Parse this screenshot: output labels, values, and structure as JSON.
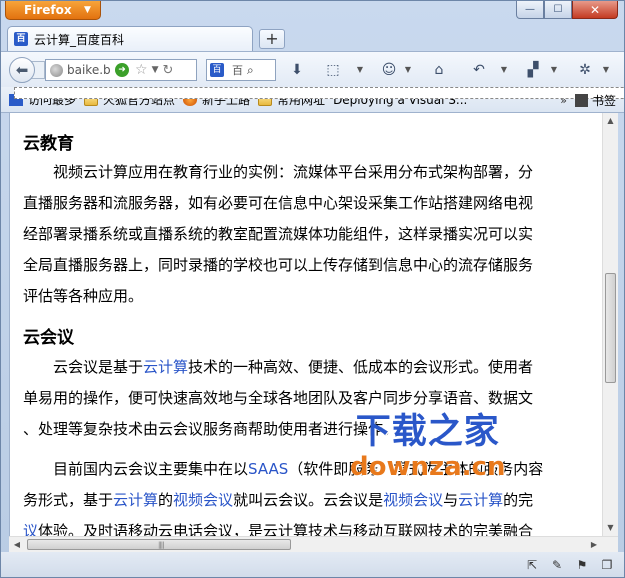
{
  "app": {
    "menu_label": "Firefox"
  },
  "window": {
    "min": "—",
    "max": "☐",
    "close": "✕"
  },
  "tabs": [
    {
      "label": "云计算_百度百科"
    }
  ],
  "tabstrip": {
    "new_tab": "+"
  },
  "nav": {
    "url_text": "baike.ba",
    "search_text": "百",
    "icons": [
      "back-icon",
      "forward-icon",
      "globe-icon",
      "go-icon",
      "star-icon",
      "reload-icon",
      "download-icon",
      "screenshot-icon",
      "smiley-icon",
      "home-icon",
      "history-icon",
      "addons-icon",
      "tools-icon"
    ]
  },
  "bookmarks": {
    "items": [
      {
        "label": "访问最多",
        "icon": "blue"
      },
      {
        "label": "火狐官方站点",
        "icon": "folder"
      },
      {
        "label": "新手上路",
        "icon": "fox"
      },
      {
        "label": "常用网址",
        "icon": "folder"
      },
      {
        "label": "Deploying a Visual S...",
        "icon": "page"
      }
    ],
    "overflow": "»",
    "bookmarks_menu_label": "书签"
  },
  "article": {
    "section1": {
      "heading": "云教育",
      "lines": [
        "　　视频云计算应用在教育行业的实例：流媒体平台采用分布式架构部署，分",
        "直播服务器和流服务器，如有必要可在信息中心架设采集工作站搭建网络电视",
        "经部署录播系统或直播系统的教室配置流媒体功能组件，这样录播实况可以实",
        "全局直播服务器上，同时录播的学校也可以上传存储到信息中心的流存储服务",
        "评估等各种应用。"
      ]
    },
    "section2": {
      "heading": "云会议",
      "p1": {
        "line1_pre": "　　云会议是基于",
        "line1_link": "云计算",
        "line1_post": "技术的一种高效、便捷、低成本的会议形式。使用者",
        "line2": "单易用的操作，便可快速高效地与全球各地团队及客户同步分享语音、数据文",
        "line3": "、处理等复杂技术由云会议服务商帮助使用者进行操作。"
      },
      "p2": {
        "line1_pre": "　　目前国内云会议主要集中在以",
        "line1_link": "SAAS",
        "line1_post": "（软件即服务）模式为主体的服务内容",
        "line2_a": "务形式，基于",
        "line2_link1": "云计算",
        "line2_b": "的",
        "line2_link2": "视频会议",
        "line2_c": "就叫云会议。云会议是",
        "line2_link3": "视频会议",
        "line2_d": "与",
        "line2_link4": "云计算",
        "line2_e": "的完",
        "line3_link": "议",
        "line3_rest": "体验。及时语移动云电话会议，是云计算技术与移动互联网技术的完美融合"
      }
    }
  },
  "watermark": {
    "line1": "下载之家",
    "line2": "downza.cn"
  },
  "status": {
    "icons": [
      "restore-icon",
      "brush-icon",
      "flag-icon",
      "window-icon"
    ]
  }
}
